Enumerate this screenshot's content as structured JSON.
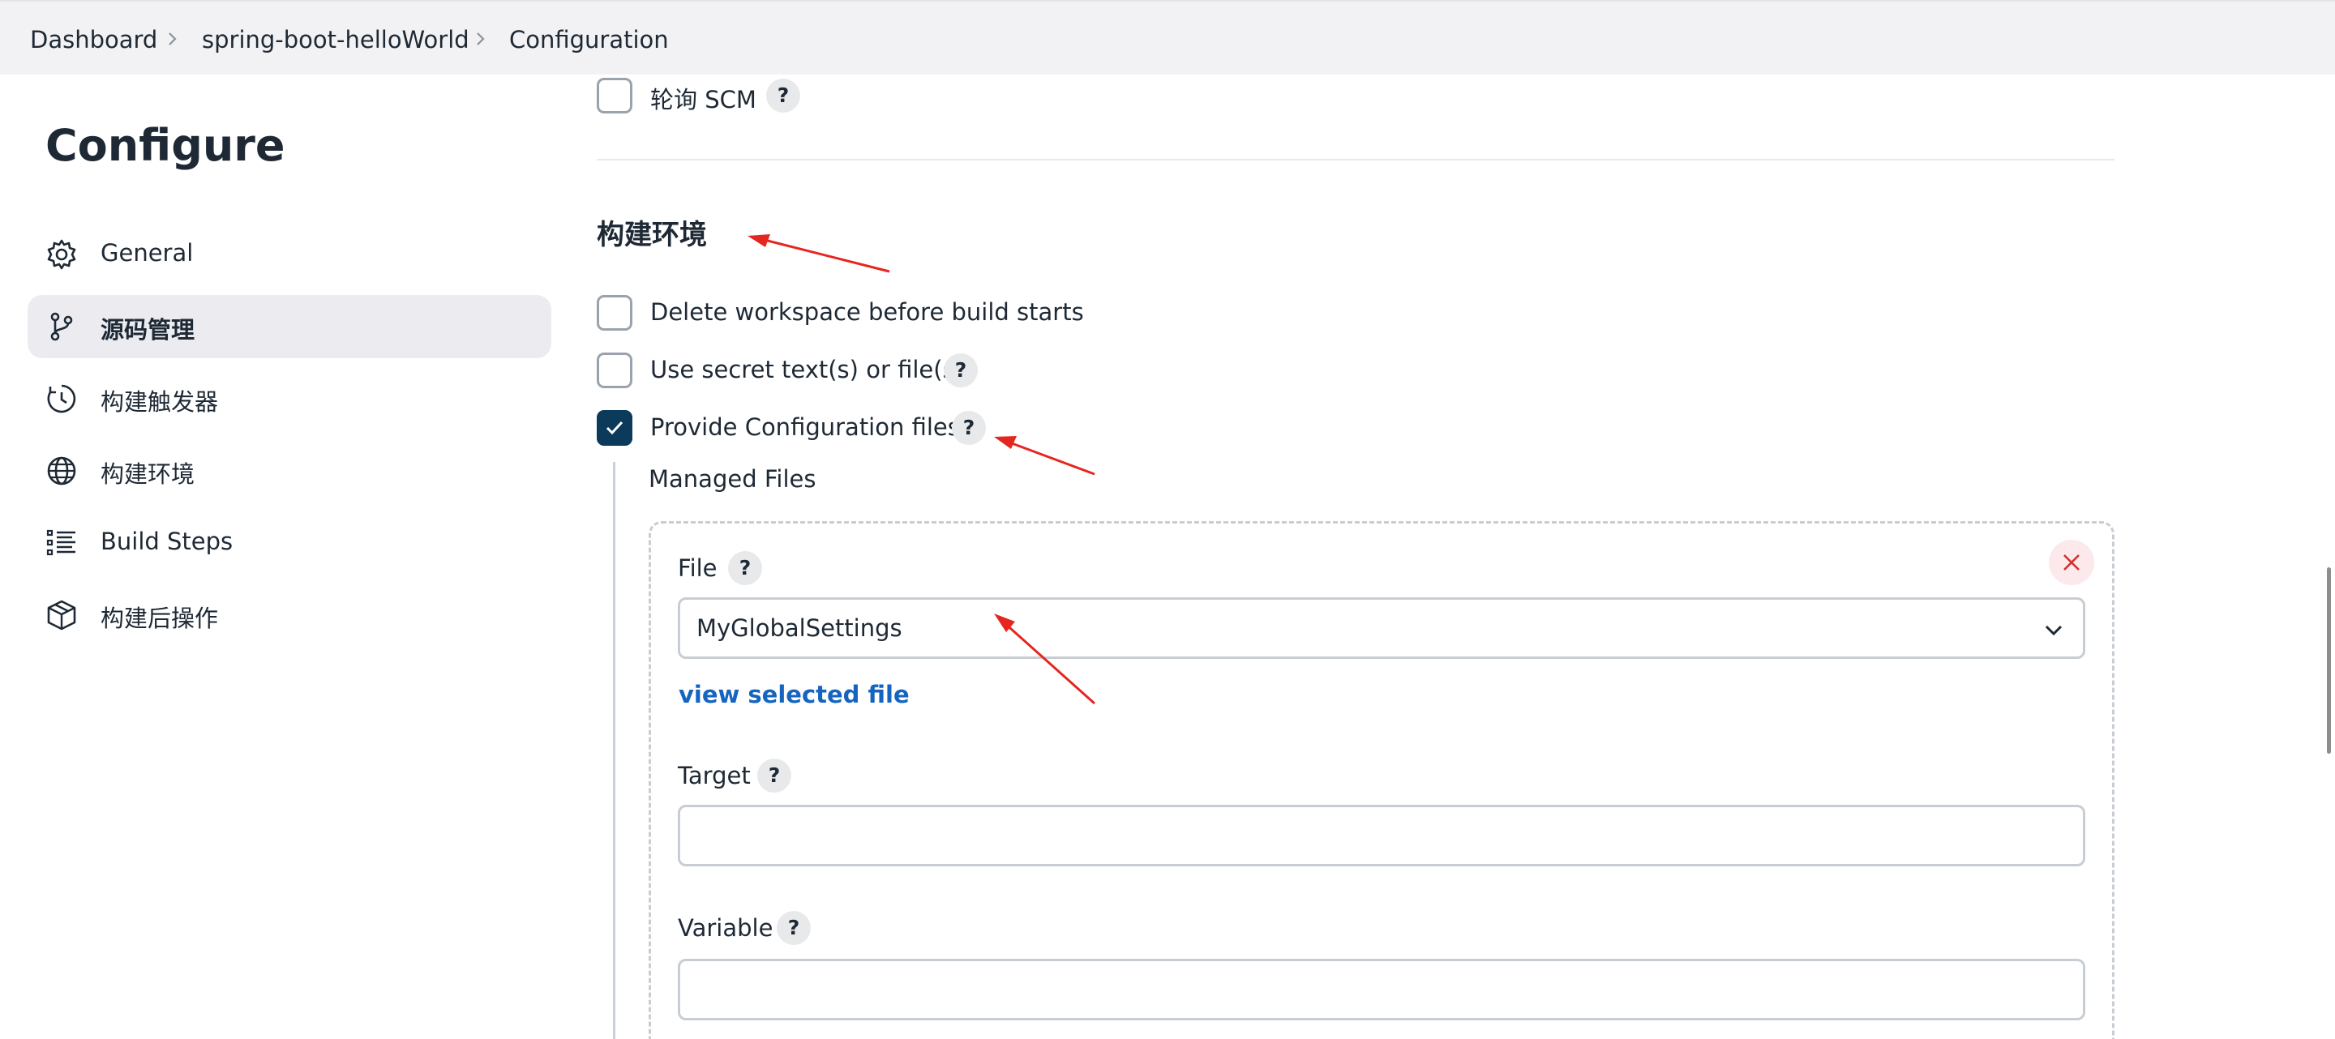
{
  "breadcrumb": {
    "items": [
      "Dashboard",
      "spring-boot-helloWorld",
      "Configuration"
    ]
  },
  "sidebar": {
    "title": "Configure",
    "items": [
      {
        "label": "General",
        "icon": "gear-icon",
        "active": false
      },
      {
        "label": "源码管理",
        "icon": "branch-icon",
        "active": true
      },
      {
        "label": "构建触发器",
        "icon": "clock-icon",
        "active": false
      },
      {
        "label": "构建环境",
        "icon": "globe-icon",
        "active": false
      },
      {
        "label": "Build Steps",
        "icon": "list-icon",
        "active": false
      },
      {
        "label": "构建后操作",
        "icon": "package-icon",
        "active": false
      }
    ]
  },
  "main": {
    "poll_scm": {
      "label": "轮询 SCM",
      "checked": false,
      "help": "?"
    },
    "section_title": "构建环境",
    "options": [
      {
        "label": "Delete workspace before build starts",
        "checked": false
      },
      {
        "label": "Use secret text(s) or file(s)",
        "checked": false,
        "help": "?"
      },
      {
        "label": "Provide Configuration files",
        "checked": true,
        "help": "?"
      }
    ],
    "managed_files_label": "Managed Files",
    "file_block": {
      "file_label": "File",
      "file_help": "?",
      "file_value": "MyGlobalSettings",
      "view_link": "view selected file",
      "target_label": "Target",
      "target_help": "?",
      "target_value": "",
      "variable_label": "Variable",
      "variable_help": "?",
      "variable_value": ""
    }
  },
  "colors": {
    "accent_checkbox": "#0b3a5a",
    "link": "#1565c0",
    "annotation_arrow": "#e52620",
    "close_icon": "#d32f2f"
  }
}
